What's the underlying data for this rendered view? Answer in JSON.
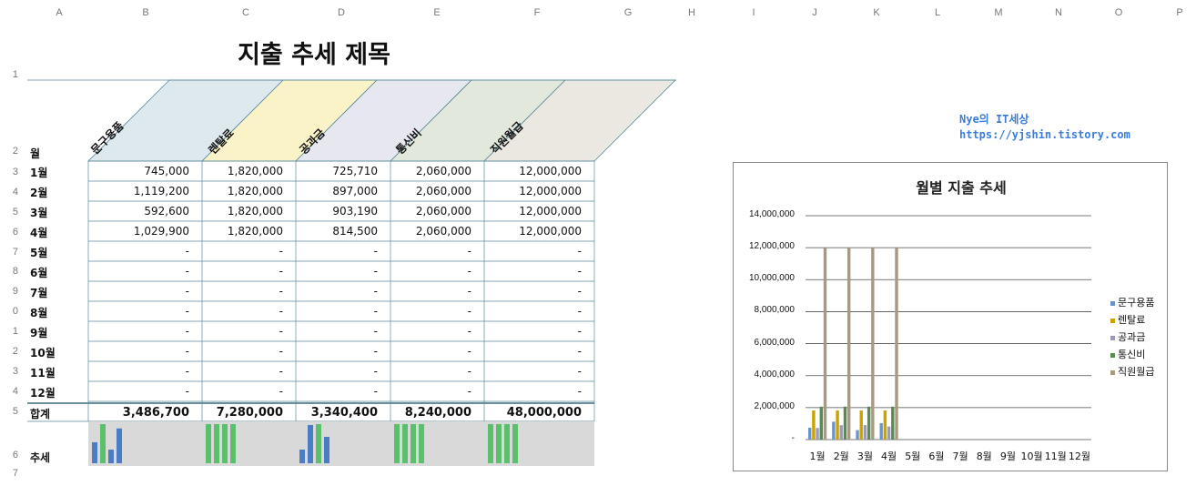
{
  "columns": [
    "A",
    "B",
    "C",
    "D",
    "E",
    "F",
    "G",
    "H",
    "I",
    "J",
    "K",
    "L",
    "M",
    "N",
    "O",
    "P"
  ],
  "row_numbers": [
    "1",
    "2",
    "3",
    "4",
    "5",
    "6",
    "7",
    "8",
    "9",
    "0",
    "1",
    "2",
    "3",
    "4",
    "5",
    "6",
    "7"
  ],
  "title": "지출 추세 제목",
  "header": {
    "month_label": "월",
    "categories": [
      "문구용품",
      "렌탈료",
      "공과금",
      "통신비",
      "직원월급"
    ]
  },
  "rows": [
    {
      "month": "1월",
      "values": [
        "745,000",
        "1,820,000",
        "725,710",
        "2,060,000",
        "12,000,000"
      ]
    },
    {
      "month": "2월",
      "values": [
        "1,119,200",
        "1,820,000",
        "897,000",
        "2,060,000",
        "12,000,000"
      ]
    },
    {
      "month": "3월",
      "values": [
        "592,600",
        "1,820,000",
        "903,190",
        "2,060,000",
        "12,000,000"
      ]
    },
    {
      "month": "4월",
      "values": [
        "1,029,900",
        "1,820,000",
        "814,500",
        "2,060,000",
        "12,000,000"
      ]
    },
    {
      "month": "5월",
      "values": [
        "-",
        "-",
        "-",
        "-",
        "-"
      ]
    },
    {
      "month": "6월",
      "values": [
        "-",
        "-",
        "-",
        "-",
        "-"
      ]
    },
    {
      "month": "7월",
      "values": [
        "-",
        "-",
        "-",
        "-",
        "-"
      ]
    },
    {
      "month": "8월",
      "values": [
        "-",
        "-",
        "-",
        "-",
        "-"
      ]
    },
    {
      "month": "9월",
      "values": [
        "-",
        "-",
        "-",
        "-",
        "-"
      ]
    },
    {
      "month": "10월",
      "values": [
        "-",
        "-",
        "-",
        "-",
        "-"
      ]
    },
    {
      "month": "11월",
      "values": [
        "-",
        "-",
        "-",
        "-",
        "-"
      ]
    },
    {
      "month": "12월",
      "values": [
        "-",
        "-",
        "-",
        "-",
        "-"
      ]
    }
  ],
  "totals": {
    "label": "합계",
    "values": [
      "3,486,700",
      "7,280,000",
      "3,340,400",
      "8,240,000",
      "48,000,000"
    ]
  },
  "trend_label": "추세",
  "blog": {
    "line1": "Nye의 IT세상",
    "line2": "https://yjshin.tistory.com"
  },
  "colors": {
    "cat1": "#6b95c9",
    "cat2": "#c9a400",
    "cat3": "#9b9bb8",
    "cat4": "#5a8a4f",
    "cat5": "#a89a7e",
    "hdr1": "#dde9ec",
    "hdr2": "#faf3c7",
    "hdr3": "#e7e7f0",
    "hdr4": "#e2e8dc",
    "hdr5": "#ebe8e2",
    "spark_bg": "#d9d9d9",
    "spark_blue": "#4a7dc4",
    "spark_green": "#5bbf6b",
    "grid": "#4d4d4d"
  },
  "chart_data": {
    "type": "bar",
    "title": "월별 지출 추세",
    "categories": [
      "1월",
      "2월",
      "3월",
      "4월",
      "5월",
      "6월",
      "7월",
      "8월",
      "9월",
      "10월",
      "11월",
      "12월"
    ],
    "series": [
      {
        "name": "문구용품",
        "values": [
          745000,
          1119200,
          592600,
          1029900,
          0,
          0,
          0,
          0,
          0,
          0,
          0,
          0
        ]
      },
      {
        "name": "렌탈료",
        "values": [
          1820000,
          1820000,
          1820000,
          1820000,
          0,
          0,
          0,
          0,
          0,
          0,
          0,
          0
        ]
      },
      {
        "name": "공과금",
        "values": [
          725710,
          897000,
          903190,
          814500,
          0,
          0,
          0,
          0,
          0,
          0,
          0,
          0
        ]
      },
      {
        "name": "통신비",
        "values": [
          2060000,
          2060000,
          2060000,
          2060000,
          0,
          0,
          0,
          0,
          0,
          0,
          0,
          0
        ]
      },
      {
        "name": "직원월급",
        "values": [
          12000000,
          12000000,
          12000000,
          12000000,
          0,
          0,
          0,
          0,
          0,
          0,
          0,
          0
        ]
      }
    ],
    "yticks": [
      "-",
      "2,000,000",
      "4,000,000",
      "6,000,000",
      "8,000,000",
      "10,000,000",
      "12,000,000",
      "14,000,000"
    ],
    "ylim": [
      0,
      14000000
    ],
    "grid": true,
    "legend": "right"
  }
}
